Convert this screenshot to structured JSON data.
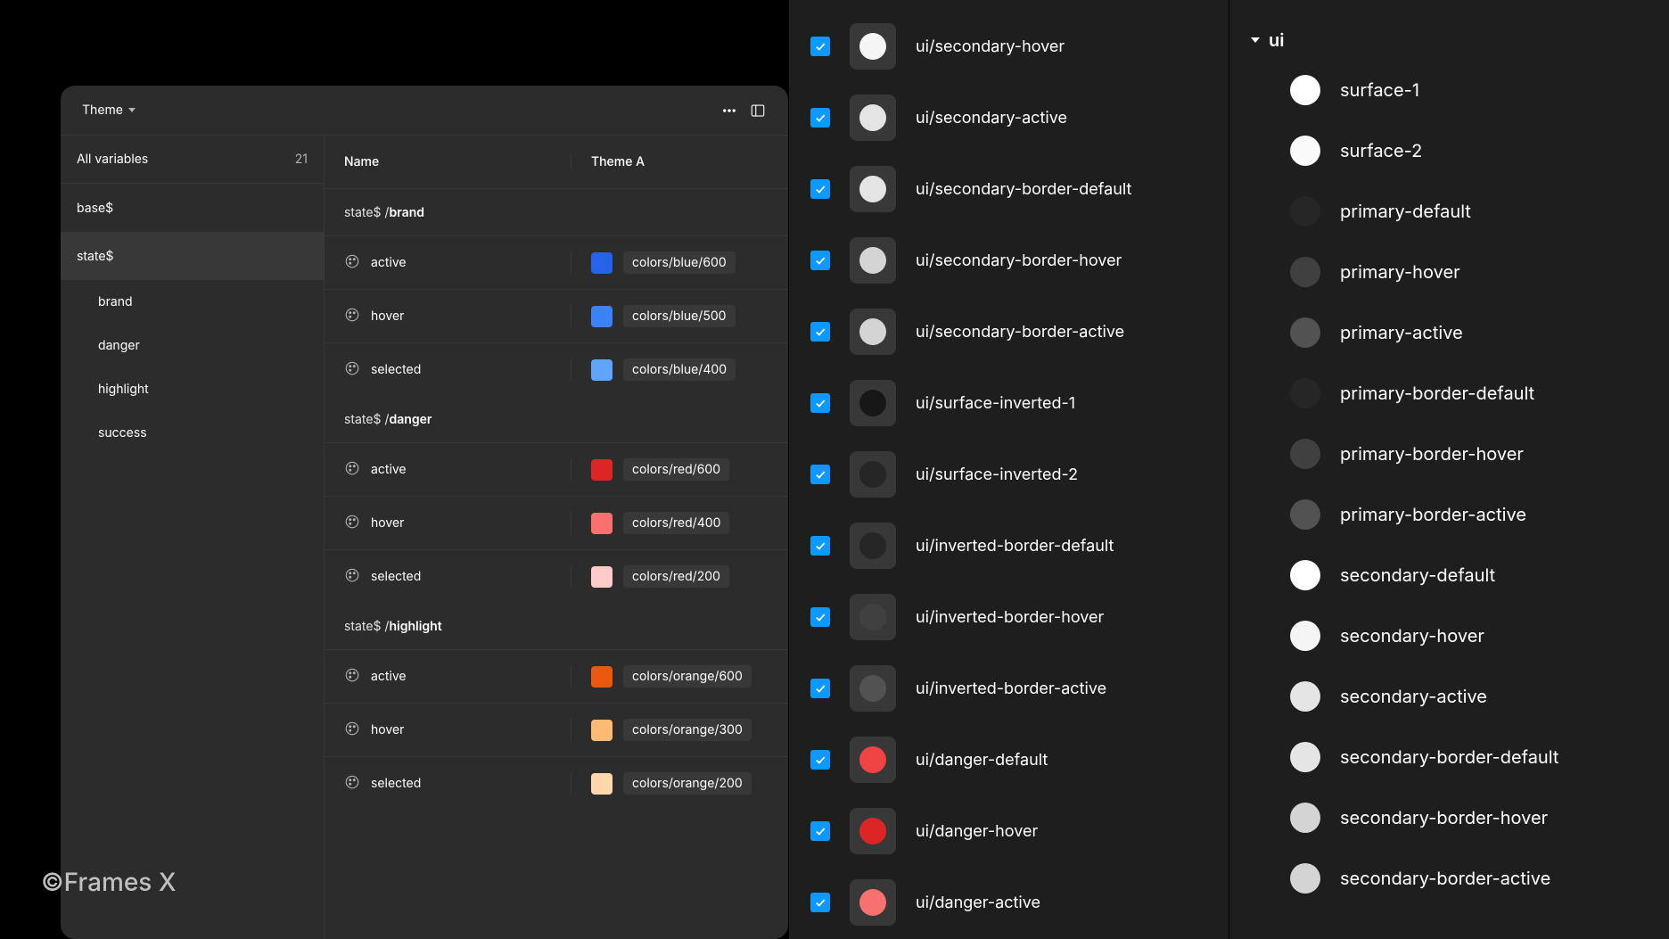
{
  "watermark": "©Frames X",
  "panel": {
    "dropdown_label": "Theme",
    "sidebar": {
      "all_variables_label": "All variables",
      "var_count": "21",
      "collections": [
        {
          "label": "base$",
          "active": false
        },
        {
          "label": "state$",
          "active": true,
          "children": [
            {
              "label": "brand"
            },
            {
              "label": "danger"
            },
            {
              "label": "highlight"
            },
            {
              "label": "success"
            }
          ]
        }
      ]
    },
    "columns": {
      "name": "Name",
      "value": "Theme A"
    },
    "groups": [
      {
        "prefix": "state$ / ",
        "emph": "brand",
        "rows": [
          {
            "name": "active",
            "color": "#2563eb",
            "value": "colors/blue/600"
          },
          {
            "name": "hover",
            "color": "#3b82f6",
            "value": "colors/blue/500"
          },
          {
            "name": "selected",
            "color": "#60a5fa",
            "value": "colors/blue/400"
          }
        ]
      },
      {
        "prefix": "state$ / ",
        "emph": "danger",
        "rows": [
          {
            "name": "active",
            "color": "#dc2626",
            "value": "colors/red/600"
          },
          {
            "name": "hover",
            "color": "#f87171",
            "value": "colors/red/400"
          },
          {
            "name": "selected",
            "color": "#fecaca",
            "value": "colors/red/200"
          }
        ]
      },
      {
        "prefix": "state$ / ",
        "emph": "highlight",
        "rows": [
          {
            "name": "active",
            "color": "#ea580c",
            "value": "colors/orange/600"
          },
          {
            "name": "hover",
            "color": "#fdba74",
            "value": "colors/orange/300"
          },
          {
            "name": "selected",
            "color": "#fed7aa",
            "value": "colors/orange/200"
          }
        ]
      }
    ]
  },
  "center_list": [
    {
      "label": "ui/secondary-hover",
      "color": "#f5f5f5"
    },
    {
      "label": "ui/secondary-active",
      "color": "#e5e5e5"
    },
    {
      "label": "ui/secondary-border-default",
      "color": "#e5e5e5"
    },
    {
      "label": "ui/secondary-border-hover",
      "color": "#d4d4d4"
    },
    {
      "label": "ui/secondary-border-active",
      "color": "#d4d4d4"
    },
    {
      "label": "ui/surface-inverted-1",
      "color": "#171717"
    },
    {
      "label": "ui/surface-inverted-2",
      "color": "#262626"
    },
    {
      "label": "ui/inverted-border-default",
      "color": "#262626"
    },
    {
      "label": "ui/inverted-border-hover",
      "color": "#404040"
    },
    {
      "label": "ui/inverted-border-active",
      "color": "#525252"
    },
    {
      "label": "ui/danger-default",
      "color": "#ef4444"
    },
    {
      "label": "ui/danger-hover",
      "color": "#dc2626"
    },
    {
      "label": "ui/danger-active",
      "color": "#f87171"
    }
  ],
  "right_tree": {
    "root": "ui",
    "items": [
      {
        "label": "surface-1",
        "color": "#ffffff"
      },
      {
        "label": "surface-2",
        "color": "#fafafa"
      },
      {
        "label": "primary-default",
        "color": "#262626"
      },
      {
        "label": "primary-hover",
        "color": "#404040"
      },
      {
        "label": "primary-active",
        "color": "#525252"
      },
      {
        "label": "primary-border-default",
        "color": "#262626"
      },
      {
        "label": "primary-border-hover",
        "color": "#404040"
      },
      {
        "label": "primary-border-active",
        "color": "#525252"
      },
      {
        "label": "secondary-default",
        "color": "#ffffff"
      },
      {
        "label": "secondary-hover",
        "color": "#f5f5f5"
      },
      {
        "label": "secondary-active",
        "color": "#e5e5e5"
      },
      {
        "label": "secondary-border-default",
        "color": "#e5e5e5"
      },
      {
        "label": "secondary-border-hover",
        "color": "#d4d4d4"
      },
      {
        "label": "secondary-border-active",
        "color": "#d4d4d4"
      }
    ]
  }
}
